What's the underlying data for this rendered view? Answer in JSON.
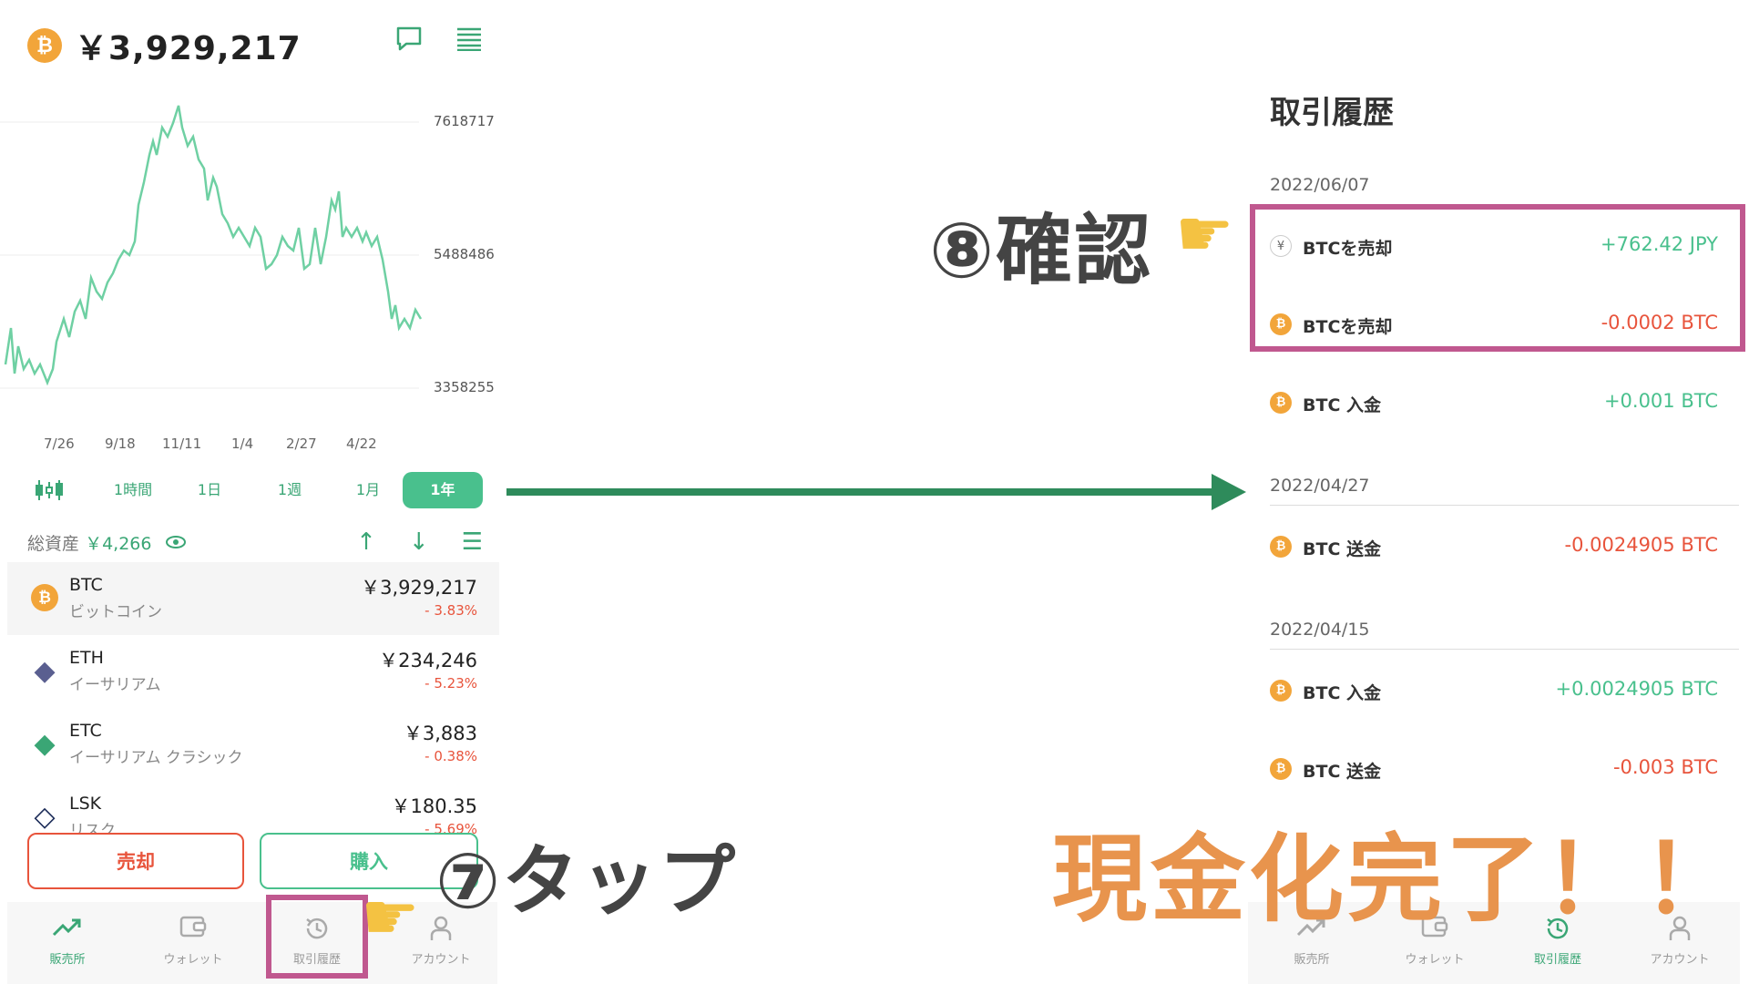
{
  "left": {
    "header": {
      "price": "￥3,929,217",
      "coin_icon": "bitcoin-icon",
      "chat_icon": "chat-icon",
      "menu_icon": "list-icon"
    },
    "chart": {
      "y_ticks": [
        "7618717",
        "5488486",
        "3358255"
      ],
      "x_ticks": [
        "7/26",
        "9/18",
        "11/11",
        "1/4",
        "2/27",
        "4/22"
      ]
    },
    "ranges": [
      "1時間",
      "1日",
      "1週",
      "1月",
      "1年"
    ],
    "active_range": "1年",
    "total": {
      "label": "総資産",
      "value": "￥4,266"
    },
    "assets": [
      {
        "symbol": "BTC",
        "name": "ビットコイン",
        "price": "￥3,929,217",
        "change": "- 3.83%"
      },
      {
        "symbol": "ETH",
        "name": "イーサリアム",
        "price": "￥234,246",
        "change": "- 5.23%"
      },
      {
        "symbol": "ETC",
        "name": "イーサリアム クラシック",
        "price": "￥3,883",
        "change": "- 0.38%"
      },
      {
        "symbol": "LSK",
        "name": "リスク",
        "price": "￥180.35",
        "change": "- 5.69%"
      }
    ],
    "buttons": {
      "sell": "売却",
      "buy": "購入"
    },
    "tabs": [
      "販売所",
      "ウォレット",
      "取引履歴",
      "アカウント"
    ]
  },
  "annotations": {
    "step7": "⑦タップ",
    "step8": "⑧確認",
    "finish": "現金化完了！！"
  },
  "right": {
    "title": "取引履歴",
    "groups": [
      {
        "date": "2022/06/07",
        "items": [
          {
            "label": "BTCを売却",
            "amount": "+762.42 JPY",
            "icon": "yen"
          },
          {
            "label": "BTCを売却",
            "amount": "-0.0002 BTC",
            "icon": "btc"
          },
          {
            "label": "BTC 入金",
            "amount": "+0.001 BTC",
            "icon": "btc"
          }
        ]
      },
      {
        "date": "2022/04/27",
        "items": [
          {
            "label": "BTC 送金",
            "amount": "-0.0024905 BTC",
            "icon": "btc"
          }
        ]
      },
      {
        "date": "2022/04/15",
        "items": [
          {
            "label": "BTC 入金",
            "amount": "+0.0024905 BTC",
            "icon": "btc"
          },
          {
            "label": "BTC 送金",
            "amount": "-0.003 BTC",
            "icon": "btc"
          }
        ]
      }
    ],
    "tabs": [
      "販売所",
      "ウォレット",
      "取引履歴",
      "アカウント"
    ]
  }
}
